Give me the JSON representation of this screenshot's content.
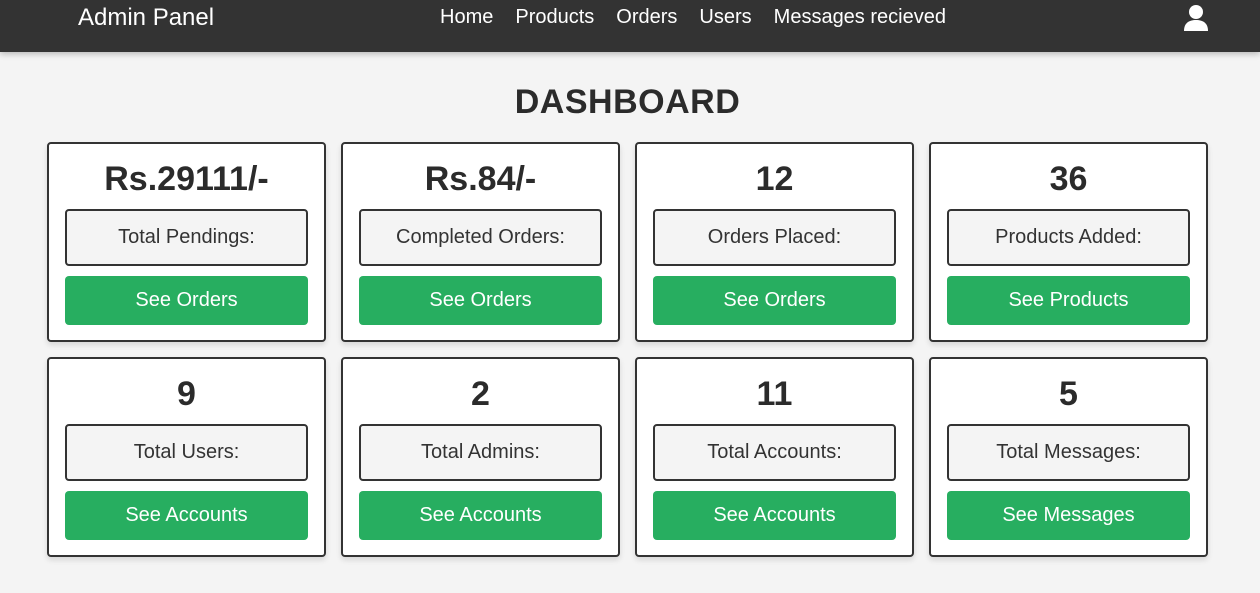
{
  "header": {
    "brand": "Admin Panel",
    "nav": [
      "Home",
      "Products",
      "Orders",
      "Users",
      "Messages recieved"
    ],
    "user_icon": "user-icon",
    "background": "#333333"
  },
  "dashboard": {
    "title": "DASHBOARD",
    "accent_color": "#27ae60",
    "cards": [
      {
        "value": "Rs.29111/-",
        "label": "Total Pendings:",
        "button": "See Orders"
      },
      {
        "value": "Rs.84/-",
        "label": "Completed Orders:",
        "button": "See Orders"
      },
      {
        "value": "12",
        "label": "Orders Placed:",
        "button": "See Orders"
      },
      {
        "value": "36",
        "label": "Products Added:",
        "button": "See Products"
      },
      {
        "value": "9",
        "label": "Total Users:",
        "button": "See Accounts"
      },
      {
        "value": "2",
        "label": "Total Admins:",
        "button": "See Accounts"
      },
      {
        "value": "11",
        "label": "Total Accounts:",
        "button": "See Accounts"
      },
      {
        "value": "5",
        "label": "Total Messages:",
        "button": "See Messages"
      }
    ]
  }
}
